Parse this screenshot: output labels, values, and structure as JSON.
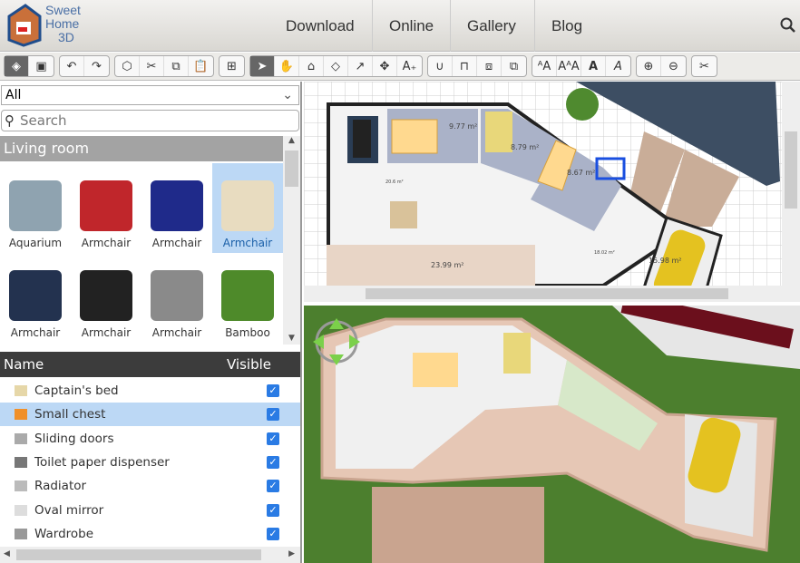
{
  "header": {
    "logo_text": [
      "Sweet",
      "Home",
      "3D"
    ],
    "nav": [
      "Download",
      "Online",
      "Gallery",
      "Blog"
    ],
    "search_icon": "search-icon"
  },
  "toolbar": {
    "groups": [
      [
        "plan-view-icon",
        "3d-view-icon"
      ],
      [
        "undo-icon",
        "redo-icon"
      ],
      [
        "add-furniture-icon",
        "cut-icon",
        "copy-icon",
        "paste-icon"
      ],
      [
        "add-text-icon"
      ],
      [
        "select-icon",
        "pan-icon",
        "create-walls-icon",
        "create-rooms-icon",
        "create-polylines-icon",
        "create-dimensions-icon",
        "add-label-icon"
      ],
      [
        "magnetism-icon",
        "lock-icon",
        "flip-icon",
        "group-icon"
      ],
      [
        "increase-text-icon",
        "decrease-text-icon",
        "bold-icon",
        "italic-icon"
      ],
      [
        "zoom-in-icon",
        "zoom-out-icon"
      ],
      [
        "preferences-icon"
      ]
    ],
    "glyphs": [
      [
        "◈",
        "▣"
      ],
      [
        "↶",
        "↷"
      ],
      [
        "⬡",
        "✂",
        "⧉",
        "📋"
      ],
      [
        "⊞"
      ],
      [
        "➤",
        "✋",
        "⌂",
        "◇",
        "↗",
        "✥",
        "A₊"
      ],
      [
        "∪",
        "⊓",
        "⧈",
        "⧉"
      ],
      [
        "ᴬA",
        "AᴬA",
        "A",
        "A"
      ],
      [
        "⊕",
        "⊖"
      ],
      [
        "✂"
      ]
    ],
    "active": [
      0,
      4
    ]
  },
  "catalog": {
    "filter": "All",
    "search_placeholder": "Search",
    "category": "Living room",
    "items": [
      {
        "label": "Aquarium",
        "color": "#8fa3b0"
      },
      {
        "label": "Armchair",
        "color": "#c0262b"
      },
      {
        "label": "Armchair",
        "color": "#1f2a8a"
      },
      {
        "label": "Armchair",
        "color": "#e8dcc0",
        "selected": true
      },
      {
        "label": "Armchair",
        "color": "#23324f"
      },
      {
        "label": "Armchair",
        "color": "#222222"
      },
      {
        "label": "Armchair",
        "color": "#8a8a8a"
      },
      {
        "label": "Bamboo",
        "color": "#4e8a2a"
      }
    ]
  },
  "furniture_table": {
    "col_name": "Name",
    "col_visible": "Visible",
    "rows": [
      {
        "name": "Captain's bed",
        "visible": true,
        "color": "#e6d7a8"
      },
      {
        "name": "Small chest",
        "visible": true,
        "selected": true,
        "color": "#f0902a"
      },
      {
        "name": "Sliding doors",
        "visible": true,
        "color": "#aaaaaa"
      },
      {
        "name": "Toilet paper dispenser",
        "visible": true,
        "color": "#777777"
      },
      {
        "name": "Radiator",
        "visible": true,
        "color": "#bbbbbb"
      },
      {
        "name": "Oval mirror",
        "visible": true,
        "color": "#dddddd"
      },
      {
        "name": "Wardrobe",
        "visible": true,
        "color": "#999999"
      }
    ]
  },
  "plan": {
    "areas": [
      "9.77 m²",
      "8.79 m²",
      "8.67 m²",
      "23.99 m²",
      "20.6 m²",
      "18.02 m²",
      "15.98 m²"
    ]
  }
}
